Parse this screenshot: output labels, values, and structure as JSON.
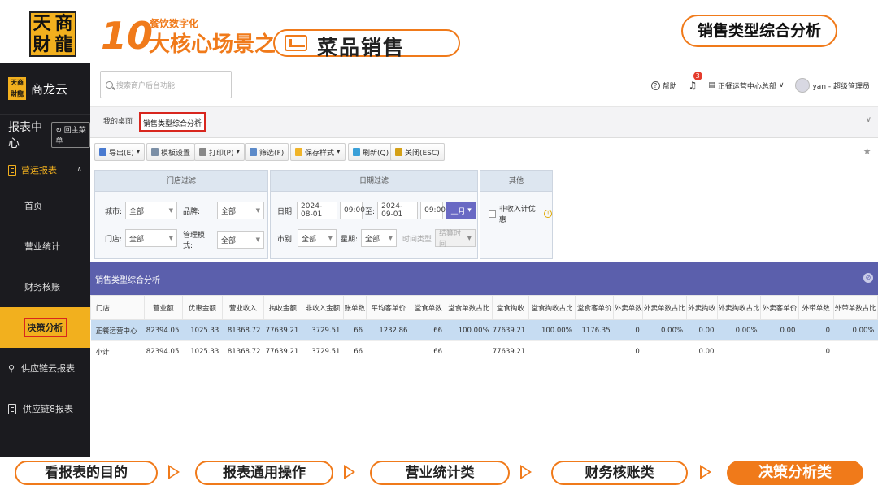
{
  "banner": {
    "logo_chars": [
      "天",
      "商",
      "財",
      "龍"
    ],
    "ten": "10",
    "subtitle": "餐饮数字化",
    "title": "大核心场景之",
    "pill": "菜品销售",
    "right_pill": "销售类型综合分析"
  },
  "sidebar": {
    "logo_text": "天商財龍",
    "brand": "商龙云",
    "report_center": "报表中心",
    "back_btn": "回主菜单",
    "group": "营运报表",
    "items": [
      {
        "label": "首页"
      },
      {
        "label": "营业统计"
      },
      {
        "label": "财务核账"
      },
      {
        "label": "决策分析"
      }
    ],
    "sub": [
      {
        "label": "供应链云报表"
      },
      {
        "label": "供应链8报表"
      }
    ]
  },
  "topbar": {
    "search_placeholder": "搜索商户后台功能",
    "help": "帮助",
    "bell_badge": "3",
    "org": "正餐运营中心总部",
    "user": "yan - 超级管理员"
  },
  "tabs": {
    "desk": "我的桌面",
    "active": "销售类型综合分析",
    "close": "×",
    "chevron": "∨"
  },
  "toolbar": {
    "export": "导出(E)",
    "template": "模板设置",
    "print": "打印(P)",
    "filter": "筛选(F)",
    "save_style": "保存样式",
    "refresh": "刷新(Q)",
    "close": "关闭(ESC)"
  },
  "filters": {
    "store_head": "门店过滤",
    "city_label": "城市:",
    "city_value": "全部",
    "brand_label": "品牌:",
    "brand_value": "全部",
    "store_label": "门店:",
    "store_value": "全部",
    "mode_label": "管理模式:",
    "mode_value": "全部",
    "date_head": "日期过滤",
    "date_label": "日期:",
    "date_from": "2024-08-01",
    "time_from": "09:00",
    "to_label": "至:",
    "date_to": "2024-09-01",
    "time_to": "09:00",
    "month_btn": "上月",
    "shift_label": "市别:",
    "shift_value": "全部",
    "week_label": "星期:",
    "week_value": "全部",
    "time_type_label": "时间类型",
    "time_type_value": "结算时间",
    "other_head": "其他",
    "non_income_label": "非收入计优惠"
  },
  "report": {
    "title": "销售类型综合分析",
    "columns": [
      "门店",
      "营业额",
      "优惠金额",
      "营业收入",
      "掏收金额",
      "非收入金额",
      "账单数",
      "平均客单价",
      "堂食单数",
      "堂食单数占比",
      "堂食掏收",
      "堂食掏收占比",
      "堂食客单价",
      "外卖单数",
      "外卖单数占比",
      "外卖掏收",
      "外卖掏收占比",
      "外卖客单价",
      "外带单数",
      "外带单数占比"
    ],
    "rows": [
      [
        "正餐运营中心",
        "82394.05",
        "1025.33",
        "81368.72",
        "77639.21",
        "3729.51",
        "66",
        "1232.86",
        "66",
        "100.00%",
        "77639.21",
        "100.00%",
        "1176.35",
        "0",
        "0.00%",
        "0.00",
        "0.00%",
        "0.00",
        "0",
        "0.00%"
      ],
      [
        "小计",
        "82394.05",
        "1025.33",
        "81368.72",
        "77639.21",
        "3729.51",
        "66",
        "",
        "66",
        "",
        "77639.21",
        "",
        "",
        "0",
        "",
        "0.00",
        "",
        "",
        "0",
        ""
      ]
    ]
  },
  "footer": {
    "items": [
      "看报表的目的",
      "报表通用操作",
      "营业统计类",
      "财务核账类",
      "决策分析类"
    ]
  },
  "colors": {
    "accent": "#f07a1a",
    "brand_yellow": "#f2b01e",
    "sidebar_bg": "#1b1b1f",
    "report_header": "#5b5fac",
    "highlight_row": "#c6dcf2"
  }
}
